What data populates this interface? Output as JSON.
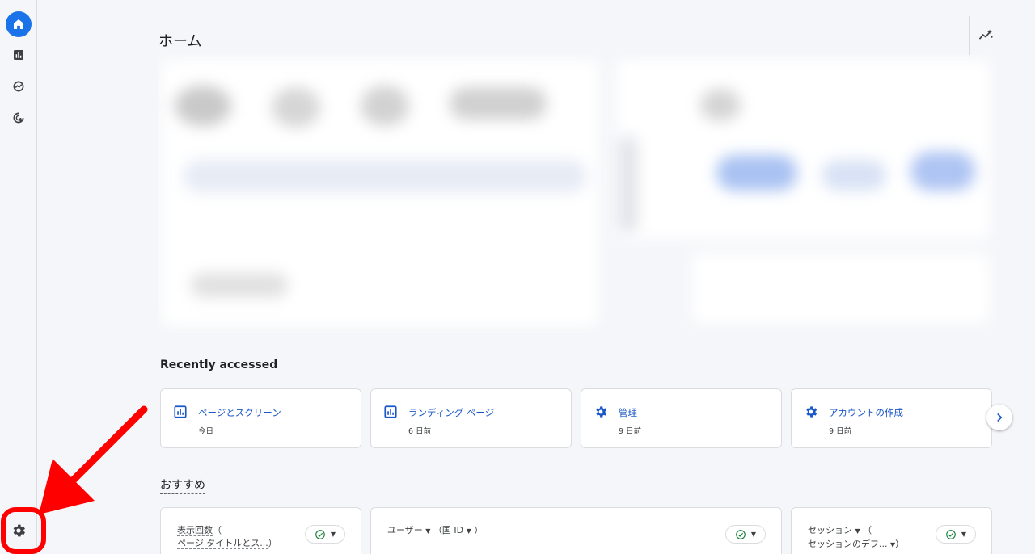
{
  "page": {
    "title": "ホーム"
  },
  "nav": {
    "items": [
      {
        "id": "home",
        "icon": "home-icon",
        "active": true
      },
      {
        "id": "reports",
        "icon": "bar-chart-icon",
        "active": false
      },
      {
        "id": "explore",
        "icon": "explore-icon",
        "active": false
      },
      {
        "id": "advertising",
        "icon": "target-cursor-icon",
        "active": false
      }
    ],
    "admin_icon": "gear-icon"
  },
  "recently_accessed": {
    "title": "Recently accessed",
    "items": [
      {
        "label": "ページとスクリーン",
        "when": "今日",
        "icon": "report-icon"
      },
      {
        "label": "ランディング ページ",
        "when": "6 日前",
        "icon": "report-icon"
      },
      {
        "label": "管理",
        "when": "9 日前",
        "icon": "gear-icon"
      },
      {
        "label": "アカウントの作成",
        "when": "9 日前",
        "icon": "gear-icon"
      }
    ]
  },
  "recommended": {
    "title": "おすすめ",
    "cards": [
      {
        "line1_a": "表示回数",
        "line1_b": "（",
        "line2": "ページ タイトルとス...",
        "line2_end": "）"
      },
      {
        "line1_a": "ユーザー",
        "line1_b": "（国 ID",
        "line1_end": "）"
      },
      {
        "line1_a": "セッション",
        "line1_b": "（",
        "line2": "セッションのデフ...",
        "line2_end": "）"
      }
    ]
  },
  "colors": {
    "accent": "#1a73e8",
    "link": "#1a57c9",
    "annotation": "#ff0000",
    "check": "#188038"
  }
}
